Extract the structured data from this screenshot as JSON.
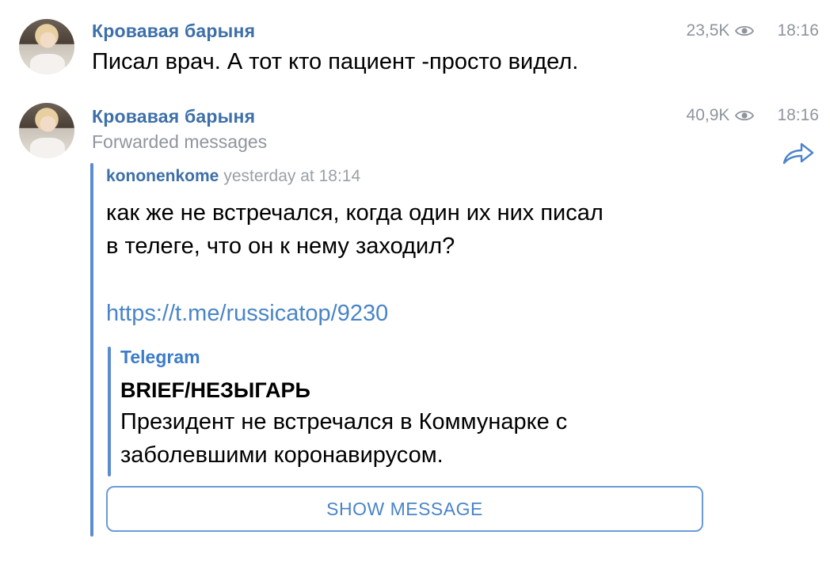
{
  "messages": [
    {
      "sender": "Кровавая барыня",
      "views": "23,5K",
      "time": "18:16",
      "text": "Писал врач. А тот кто пациент -просто видел."
    },
    {
      "sender": "Кровавая барыня",
      "views": "40,9K",
      "time": "18:16",
      "forwarded_label": "Forwarded messages",
      "forwarded": {
        "author": "kononenkome",
        "time": "yesterday at 18:14",
        "text_line1": "как же не встречался, когда один их них писал",
        "text_line2": "в телеге, что он к нему заходил?",
        "link": "https://t.me/russicatop/9230",
        "preview": {
          "site": "Telegram",
          "title": "BRIEF/НЕЗЫГАРЬ",
          "desc_line1": "Президент не встречался в Коммунарке с",
          "desc_line2": "заболевшими коронавирусом."
        },
        "button": "SHOW MESSAGE"
      }
    }
  ],
  "icons": [
    "avatar",
    "eye-icon",
    "share-icon"
  ],
  "colors": {
    "accent": "#3d6fa8",
    "link": "#4a84c8",
    "muted": "#8f959d",
    "bar": "#5b8ccf"
  }
}
